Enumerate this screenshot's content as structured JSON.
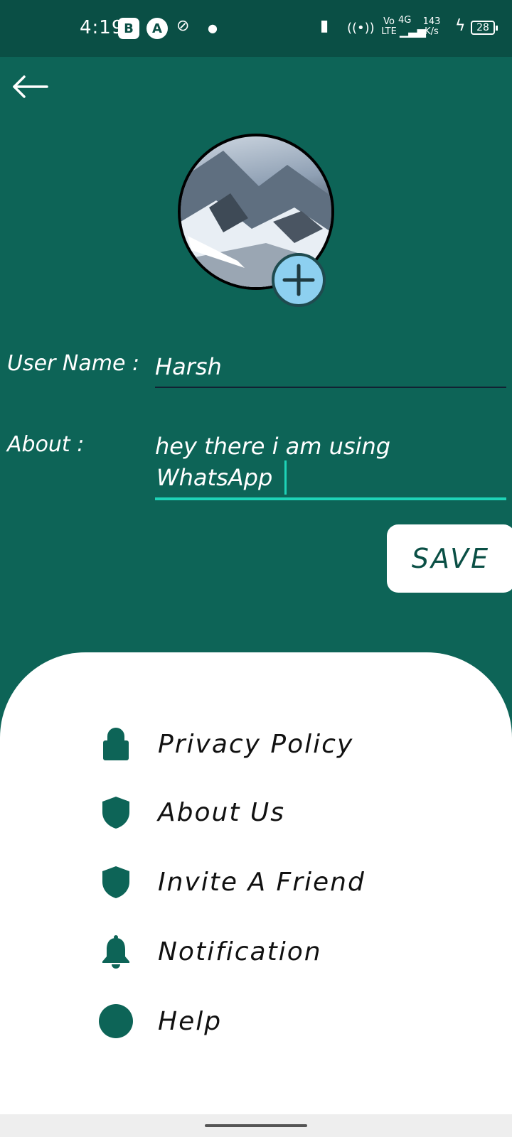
{
  "status_bar": {
    "time": "4:19",
    "badge_b": "B",
    "badge_a": "A",
    "network_top": "Vo",
    "network_bottom": "LTE",
    "network_gen": "4G",
    "speed_value": "143",
    "speed_unit": "K/s",
    "battery": "28"
  },
  "profile": {
    "username_label": "User Name :",
    "username_value": "Harsh",
    "about_label": "About :",
    "about_value_line1": "hey there i am using",
    "about_value_line2": "WhatsApp"
  },
  "actions": {
    "save_label": "SAVE"
  },
  "menu": {
    "items": [
      {
        "label": "Privacy Policy",
        "icon": "lock-icon"
      },
      {
        "label": "About Us",
        "icon": "shield-icon"
      },
      {
        "label": "Invite A Friend",
        "icon": "shield-icon"
      },
      {
        "label": "Notification",
        "icon": "bell-icon"
      },
      {
        "label": "Help",
        "icon": "circle-icon"
      }
    ]
  },
  "colors": {
    "background": "#0d6457",
    "status_bar": "#0a4f45",
    "accent": "#1ed3b7",
    "add_photo": "#8dd0f0"
  }
}
